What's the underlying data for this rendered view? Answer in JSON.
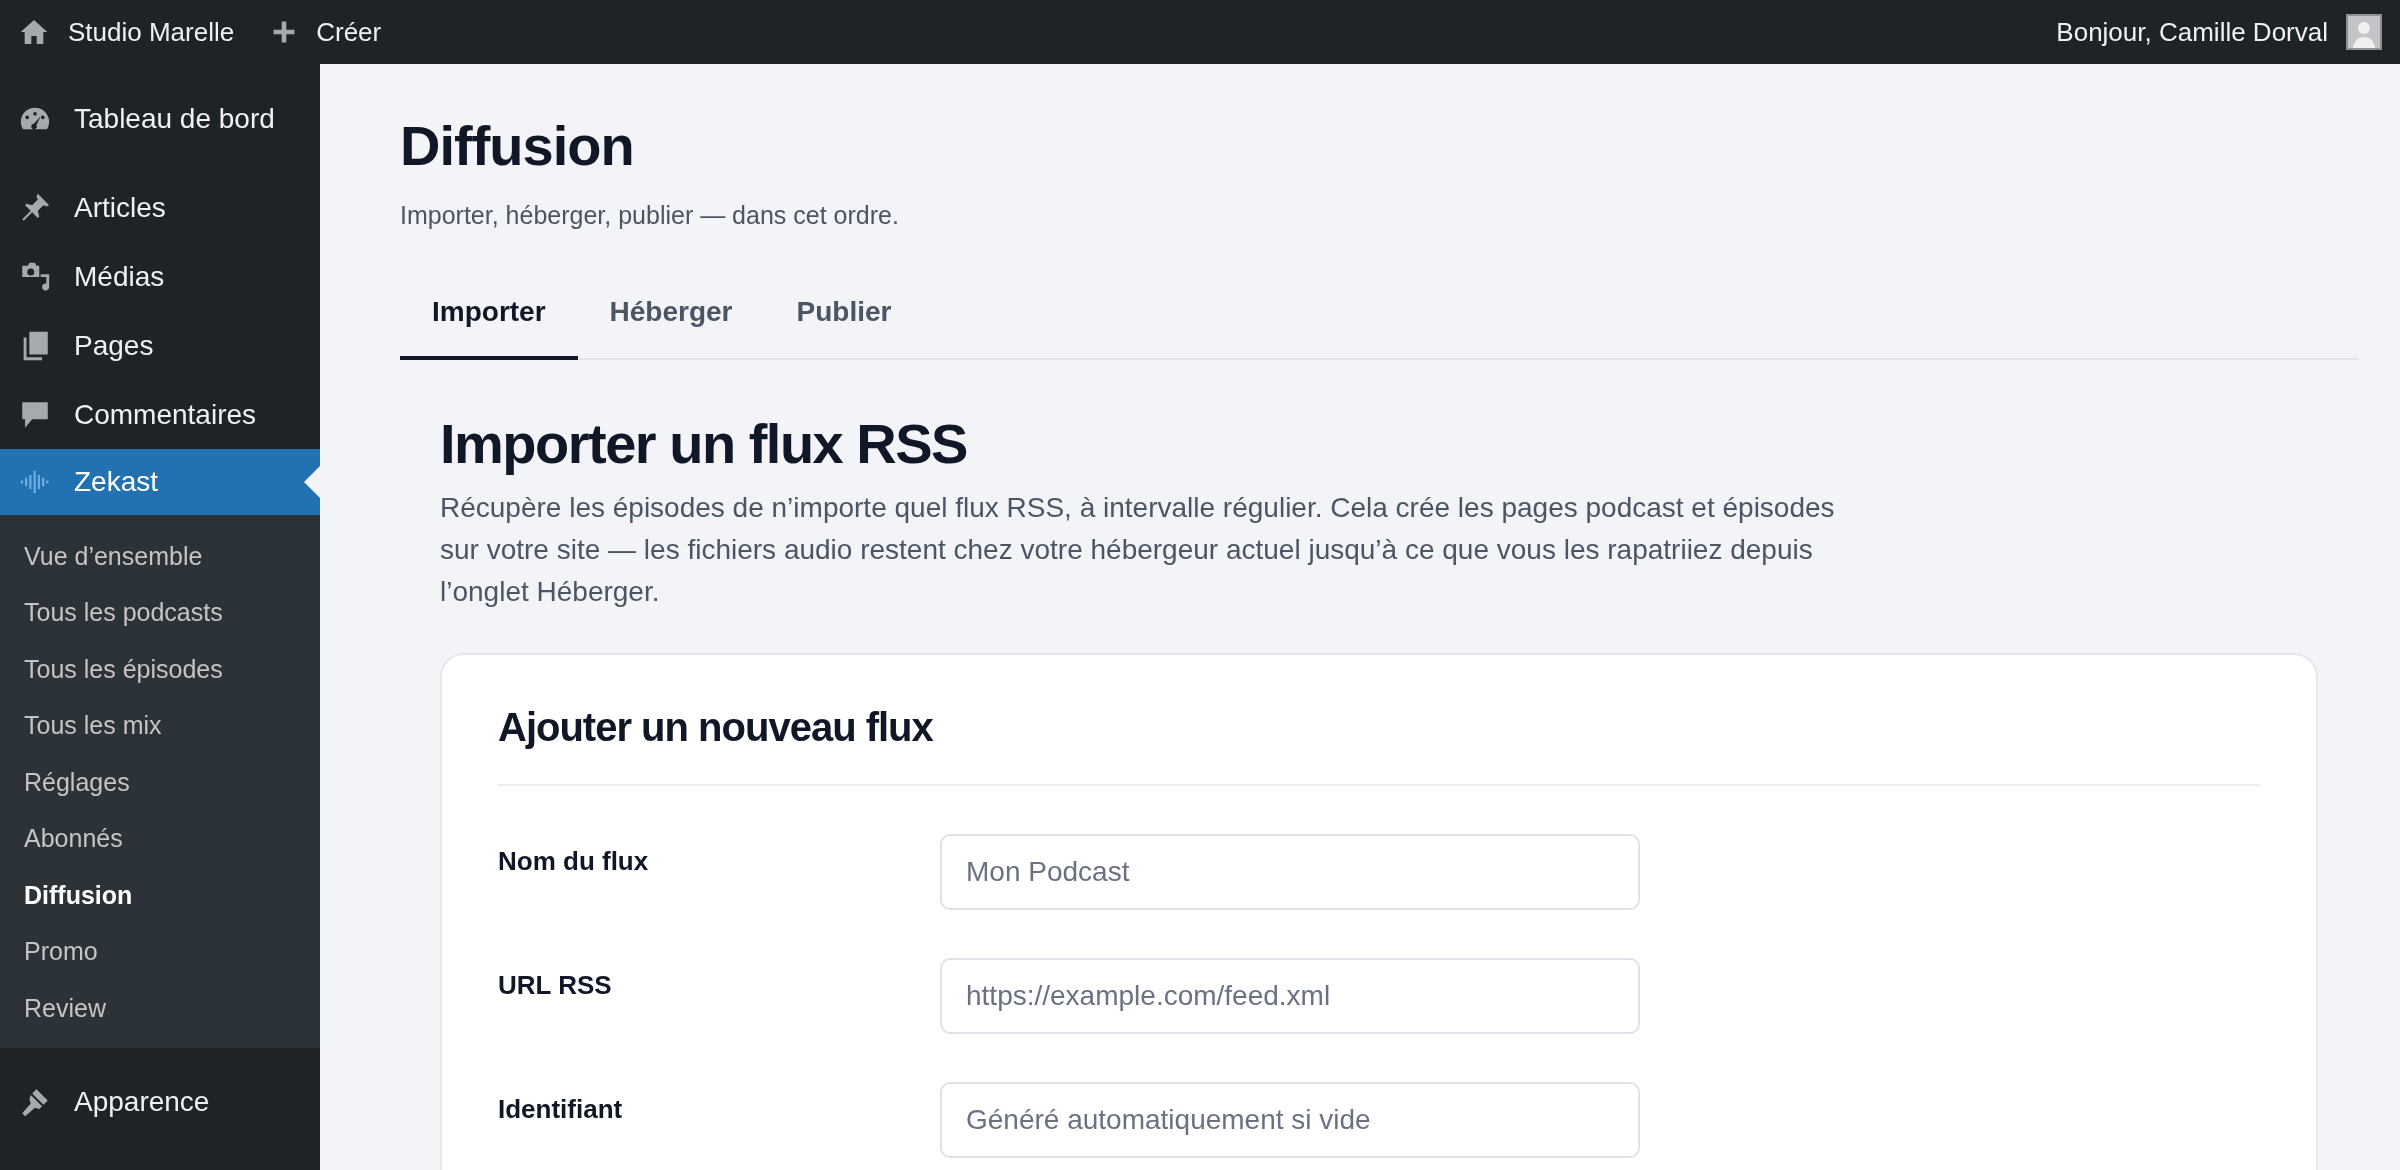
{
  "top_bar": {
    "site_name": "Studio Marelle",
    "new_label": "Créer",
    "greeting": "Bonjour, Camille Dorval"
  },
  "sidebar": {
    "groups": [
      [
        {
          "kind": "dashboard",
          "label": "Tableau de bord",
          "selected": false
        }
      ],
      [
        {
          "kind": "pin",
          "label": "Articles",
          "selected": false
        },
        {
          "kind": "media",
          "label": "Médias",
          "selected": false
        },
        {
          "kind": "pages",
          "label": "Pages",
          "selected": false
        },
        {
          "kind": "comment",
          "label": "Commentaires",
          "selected": false
        },
        {
          "kind": "wave",
          "label": "Zekast",
          "selected": true,
          "children": [
            {
              "label": "Vue d’ensemble",
              "selected": false
            },
            {
              "label": "Tous les podcasts",
              "selected": false
            },
            {
              "label": "Tous les épisodes",
              "selected": false
            },
            {
              "label": "Tous les mix",
              "selected": false
            },
            {
              "label": "Réglages",
              "selected": false
            },
            {
              "label": "Abonnés",
              "selected": false
            },
            {
              "label": "Diffusion",
              "selected": true
            },
            {
              "label": "Promo",
              "selected": false
            },
            {
              "label": "Review",
              "selected": false
            }
          ]
        }
      ],
      [
        {
          "kind": "brush",
          "label": "Apparence",
          "selected": false
        }
      ]
    ]
  },
  "page": {
    "title": "Diffusion",
    "subtitle": "Importer, héberger, publier — dans cet ordre.",
    "tabs": [
      {
        "label": "Importer",
        "selected": true
      },
      {
        "label": "Héberger",
        "selected": false
      },
      {
        "label": "Publier",
        "selected": false
      }
    ],
    "section": {
      "title": "Importer un flux RSS",
      "description": "Récupère les épisodes de n’importe quel flux RSS, à intervalle régulier. Cela crée les pages podcast et épisodes sur votre site — les fichiers audio restent chez votre hébergeur actuel jusqu’à ce que vous les rapatriiez depuis l’onglet Héberger."
    },
    "card": {
      "title": "Ajouter un nouveau flux",
      "fields": [
        {
          "label": "Nom du flux",
          "placeholder": "Mon Podcast"
        },
        {
          "label": "URL RSS",
          "placeholder": "https://example.com/feed.xml"
        },
        {
          "label": "Identifiant",
          "placeholder": "Généré automatiquement si vide"
        }
      ]
    }
  }
}
